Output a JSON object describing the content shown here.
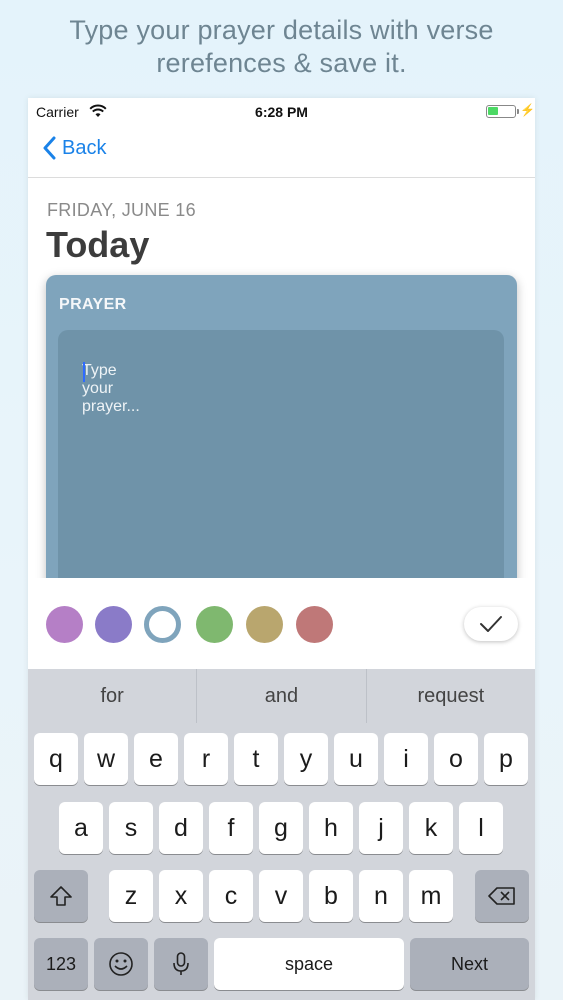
{
  "caption": {
    "line1": "Type your prayer details with verse",
    "line2": "rerefences & save it."
  },
  "status_bar": {
    "carrier": "Carrier",
    "time": "6:28 PM"
  },
  "nav": {
    "back_label": "Back"
  },
  "header": {
    "date": "FRIDAY, JUNE 16",
    "title": "Today"
  },
  "card": {
    "label": "PRAYER",
    "input_text": "Type your prayer...",
    "color": "#7fa4bc"
  },
  "colors": [
    "#b57fc6",
    "#8a7bc8",
    "#7fa4bc",
    "#7fb86f",
    "#b9a66e",
    "#bf7878"
  ],
  "selected_color_index": 2,
  "suggestions": [
    "for",
    "and",
    "request"
  ],
  "keyboard": {
    "row1": [
      "q",
      "w",
      "e",
      "r",
      "t",
      "y",
      "u",
      "i",
      "o",
      "p"
    ],
    "row2": [
      "a",
      "s",
      "d",
      "f",
      "g",
      "h",
      "j",
      "k",
      "l"
    ],
    "row3": [
      "z",
      "x",
      "c",
      "v",
      "b",
      "n",
      "m"
    ],
    "numbers_label": "123",
    "space_label": "space",
    "next_label": "Next"
  }
}
